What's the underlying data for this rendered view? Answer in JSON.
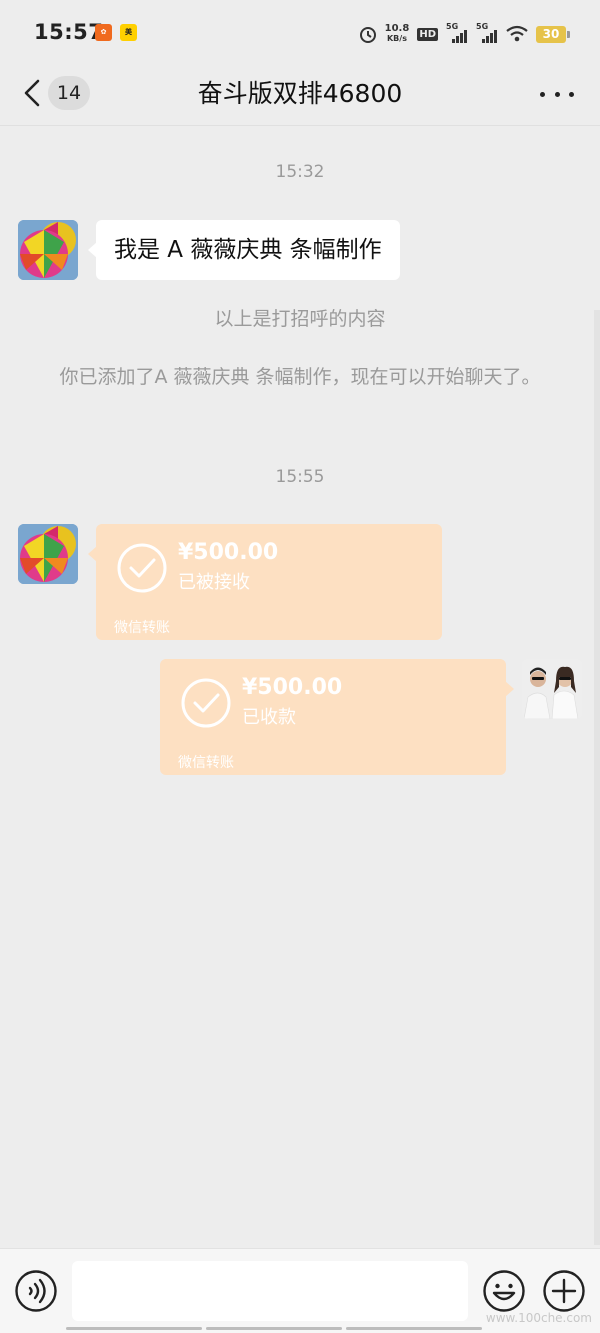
{
  "status_bar": {
    "time": "15:57",
    "net_speed_value": "10.8",
    "net_speed_unit": "KB/s",
    "hd_label": "HD",
    "sim1_label": "5G",
    "sim2_label": "5G",
    "battery": "30"
  },
  "nav": {
    "unread_count": "14",
    "title": "奋斗版双排46800"
  },
  "chat": {
    "timestamp_1": "15:32",
    "greeting_message": "我是 A 薇薇庆典 条幅制作",
    "system_msg_1": "以上是打招呼的内容",
    "system_msg_2": "你已添加了A 薇薇庆典 条幅制作，现在可以开始聊天了。",
    "timestamp_2": "15:55",
    "transfer_received": {
      "amount": "¥500.00",
      "status": "已被接收",
      "footer": "微信转账"
    },
    "transfer_sent": {
      "amount": "¥500.00",
      "status": "已收款",
      "footer": "微信转账"
    }
  },
  "input_bar": {
    "placeholder": ""
  },
  "colors": {
    "background": "#ededed",
    "transfer_bubble": "#fde0c2",
    "text_bubble": "#ffffff",
    "system_text": "#9a9a9a"
  },
  "icons": [
    "back-chevron-icon",
    "more-dots-icon",
    "check-circle-icon",
    "voice-icon",
    "emoji-icon",
    "plus-icon"
  ],
  "watermark": "www.100che.com"
}
